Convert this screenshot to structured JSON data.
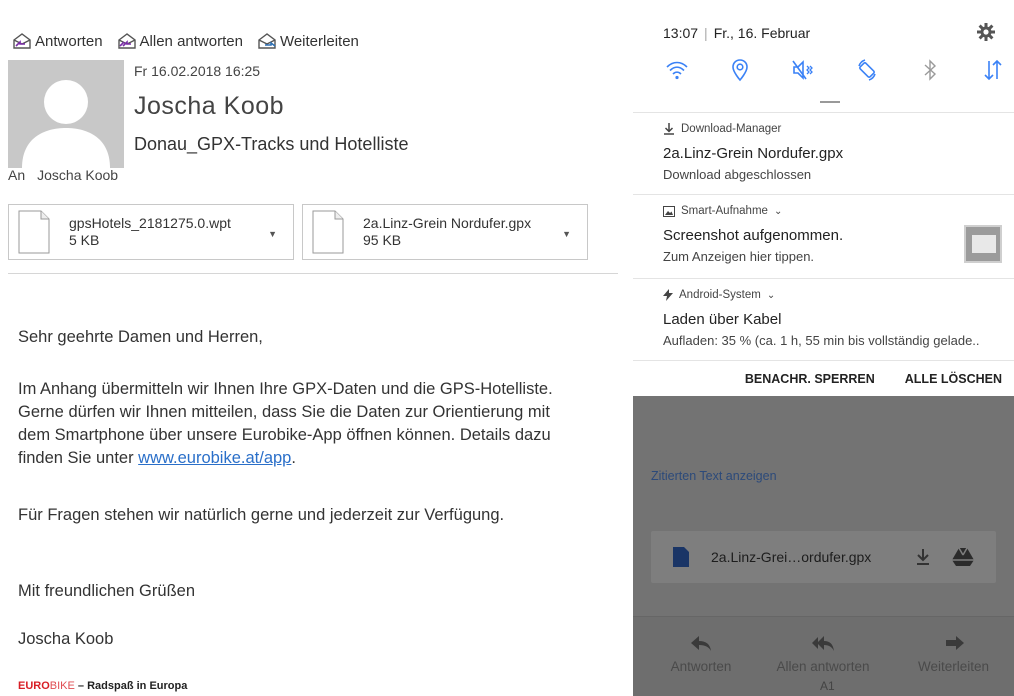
{
  "email": {
    "toolbar": {
      "reply": "Antworten",
      "reply_all": "Allen antworten",
      "forward": "Weiterleiten"
    },
    "date": "Fr 16.02.2018 16:25",
    "sender": "Joscha Koob",
    "subject": "Donau_GPX-Tracks und Hotelliste",
    "to_label": "An",
    "to_name": "Joscha Koob",
    "attachments": [
      {
        "name": "gpsHotels_2181275.0.wpt",
        "size": "5 KB"
      },
      {
        "name": "2a.Linz-Grein Nordufer.gpx",
        "size": "95 KB"
      }
    ],
    "body": {
      "greeting": "Sehr geehrte Damen und Herren,",
      "p1_line1": "Im Anhang übermitteln wir Ihnen Ihre GPX-Daten und die GPS-Hotelliste.",
      "p1_line2": "Gerne dürfen wir Ihnen mitteilen, dass Sie die Daten zur Orientierung mit",
      "p1_line3": "dem Smartphone über unsere Eurobike-App öffnen können. Details dazu",
      "p1_line4_pre": "finden Sie unter ",
      "p1_link": "www.eurobike.at/app",
      "p1_line4_post": ".",
      "p2": "Für Fragen stehen wir natürlich gerne und jederzeit zur Verfügung.",
      "closing": "Mit freundlichen Grüßen",
      "signature_name": "Joscha Koob"
    },
    "signature": {
      "brand_euro": "EURO",
      "brand_bike": "BIKE",
      "tagline": "– Radspaß in Europa"
    }
  },
  "phone": {
    "status": {
      "time": "13:07",
      "date": "Fr., 16. Februar"
    },
    "quick_settings": [
      "wifi-icon",
      "location-icon",
      "mute-icon",
      "auto-rotate-icon",
      "bluetooth-icon",
      "data-icon"
    ],
    "notifications": [
      {
        "app": "Download-Manager",
        "title": "2a.Linz-Grein Nordufer.gpx",
        "text": "Download abgeschlossen"
      },
      {
        "app": "Smart-Aufnahme",
        "title": "Screenshot aufgenommen.",
        "text": "Zum Anzeigen hier tippen."
      },
      {
        "app": "Android-System",
        "title": "Laden über Kabel",
        "text": "Aufladen: 35 % (ca. 1 h, 55 min bis vollständig gelade.."
      }
    ],
    "actions": {
      "block": "BENACHR. SPERREN",
      "clear": "ALLE LÖSCHEN"
    },
    "gmail": {
      "ghost_link": "Zitierten Text anzeigen",
      "quoted_link": "Zitierten Text anzeigen",
      "attachment": "2a.Linz-Grei…ordufer.gpx",
      "reply": "Antworten",
      "reply_all": "Allen antworten",
      "forward": "Weiterleiten",
      "carrier": "A1"
    }
  }
}
